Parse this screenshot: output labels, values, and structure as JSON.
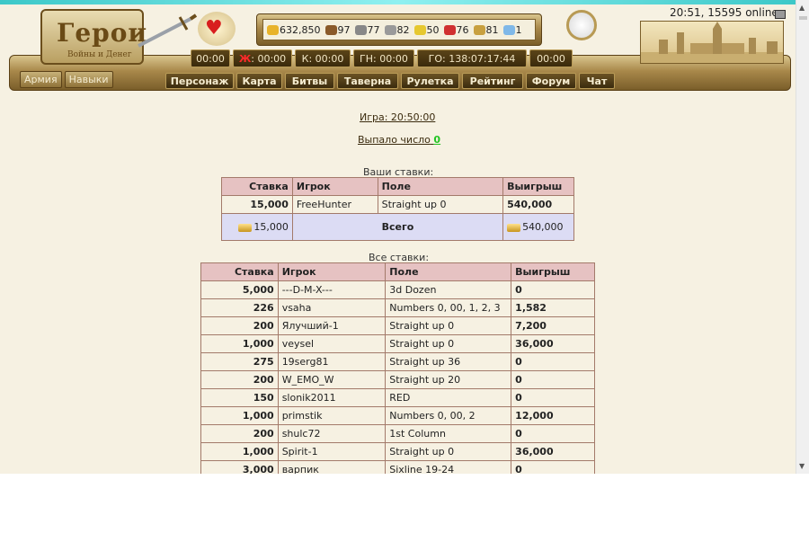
{
  "header": {
    "logo_title": "Герои",
    "logo_subtitle": "Войны и Денег",
    "online": "20:51, 15595 online",
    "resources": [
      {
        "icon": "gold-icon",
        "value": "632,850",
        "color": "#e8b32a"
      },
      {
        "icon": "wood-icon",
        "value": "97",
        "color": "#8a5a2a"
      },
      {
        "icon": "ore-icon",
        "value": "77",
        "color": "#888888"
      },
      {
        "icon": "mercury-icon",
        "value": "82",
        "color": "#9a9a9a"
      },
      {
        "icon": "sulfur-icon",
        "value": "50",
        "color": "#e6c830"
      },
      {
        "icon": "crystal-icon",
        "value": "76",
        "color": "#d03030"
      },
      {
        "icon": "gems-icon",
        "value": "81",
        "color": "#c8a040"
      },
      {
        "icon": "diamond-icon",
        "value": "1",
        "color": "#7fb8e8"
      }
    ],
    "timers": [
      {
        "label": "00:00"
      },
      {
        "label_red": "Ж",
        "label": ": 00:00"
      },
      {
        "label": "К: 00:00"
      },
      {
        "label": "ГН: 00:00"
      },
      {
        "label": "ГО: 138:07:17:44"
      },
      {
        "label": "00:00"
      }
    ],
    "army_buttons": [
      "Армия",
      "Навыки"
    ],
    "nav": [
      "Персонаж",
      "Карта",
      "Битвы",
      "Таверна",
      "Рулетка",
      "Рейтинг",
      "Форум",
      "Чат"
    ]
  },
  "roulette": {
    "game_link": "Игра: 20:50:00",
    "dropped_label": "Выпало число",
    "dropped_number": "0"
  },
  "my_bets": {
    "caption": "Ваши ставки:",
    "headers": [
      "Ставка",
      "Игрок",
      "Поле",
      "Выигрыш"
    ],
    "rows": [
      {
        "stake": "15,000",
        "player": "FreeHunter",
        "field": "Straight up 0",
        "win": "540,000"
      }
    ],
    "total": {
      "stake": "15,000",
      "label": "Всего",
      "win": "540,000"
    }
  },
  "all_bets": {
    "caption": "Все ставки:",
    "headers": [
      "Ставка",
      "Игрок",
      "Поле",
      "Выигрыш"
    ],
    "rows": [
      {
        "stake": "5,000",
        "player": "---D-M-X---",
        "field": "3d Dozen",
        "win": "0"
      },
      {
        "stake": "226",
        "player": "vsaha",
        "field": "Numbers 0, 00, 1, 2, 3",
        "win": "1,582"
      },
      {
        "stake": "200",
        "player": "Ялучший-1",
        "field": "Straight up 0",
        "win": "7,200"
      },
      {
        "stake": "1,000",
        "player": "veysel",
        "field": "Straight up 0",
        "win": "36,000"
      },
      {
        "stake": "275",
        "player": "19serg81",
        "field": "Straight up 36",
        "win": "0"
      },
      {
        "stake": "200",
        "player": "W_EMO_W",
        "field": "Straight up 20",
        "win": "0"
      },
      {
        "stake": "150",
        "player": "slonik2011",
        "field": "RED",
        "win": "0"
      },
      {
        "stake": "1,000",
        "player": "primstik",
        "field": "Numbers 0, 00, 2",
        "win": "12,000"
      },
      {
        "stake": "200",
        "player": "shulc72",
        "field": "1st Column",
        "win": "0"
      },
      {
        "stake": "1,000",
        "player": "Spirit-1",
        "field": "Straight up 0",
        "win": "36,000"
      },
      {
        "stake": "3,000",
        "player": "варпик",
        "field": "Sixline 19-24",
        "win": "0"
      }
    ]
  }
}
